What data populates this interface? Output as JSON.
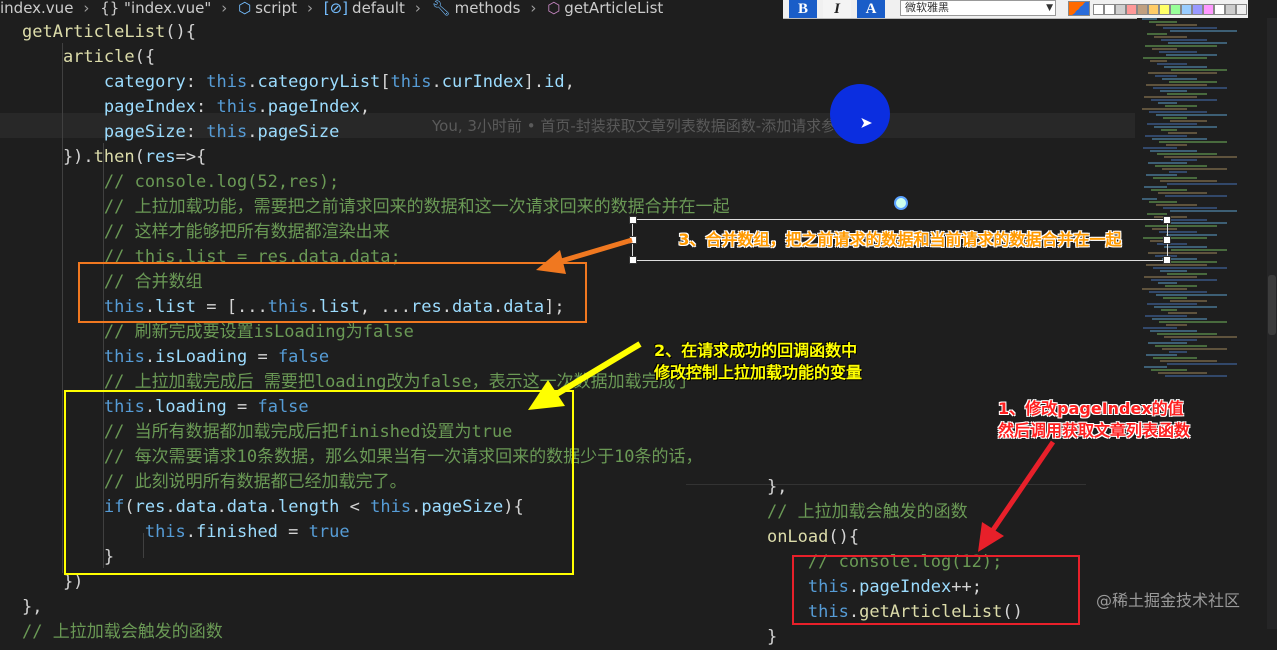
{
  "breadcrumb": [
    "index.vue",
    "{} \"index.vue\"",
    "script",
    "default",
    "methods",
    "getArticleList"
  ],
  "toolbar": {
    "bold": "B",
    "italic": "I",
    "color_a": "A",
    "font_name": "微软雅黑"
  },
  "code_lines": [
    "getArticleList(){",
    "    article({",
    "        category: this.categoryList[this.curIndex].id,",
    "        pageIndex: this.pageIndex,",
    "        pageSize: this.pageSize",
    "    }).then(res=>{",
    "        // console.log(52,res);",
    "        // 上拉加载功能，需要把之前请求回来的数据和这一次请求回来的数据合并在一起",
    "        // 这样才能够把所有数据都渲染出来",
    "        // this.list = res.data.data;",
    "        // 合并数组",
    "        this.list = [...this.list, ...res.data.data];",
    "        // 刷新完成要设置isLoading为false",
    "        this.isLoading = false",
    "        // 上拉加载完成后 需要把loading改为false，表示这一次数据加载完成了",
    "        this.loading = false",
    "        // 当所有数据都加载完成后把finished设置为true",
    "        // 每次需要请求10条数据，那么如果当有一次请求回来的数据少于10条的话，",
    "        // 此刻说明所有数据都已经加载完了。",
    "        if(res.data.data.length < this.pageSize){",
    "            this.finished = true",
    "        }",
    "    })",
    "},",
    "// 上拉加载会触发的函数"
  ],
  "blame": "You, 3小时前 • 首页-封装获取文章列表数据函数-添加请求参数 …",
  "inset_lines": [
    "    },",
    "    // 上拉加载会触发的函数",
    "    onLoad(){",
    "        // console.log(12);",
    "        this.pageIndex++;",
    "        this.getArticleList()",
    "    }"
  ],
  "callouts": {
    "step3": "3、合并数组，把之前请求的数据和当前请求的数据合并在一起",
    "step2_line1": "2、在请求成功的回调函数中",
    "step2_line2": "修改控制上拉加载功能的变量",
    "step1_line1": "1、修改pageIndex的值",
    "step1_line2": "然后调用获取文章列表函数"
  },
  "watermark": "@稀土掘金技术社区",
  "colors": {
    "editor_bg": "#1e1e1e",
    "keyword": "#569cd6",
    "property": "#9cdcfe",
    "comment": "#6a9955",
    "orange_box": "#f07820",
    "yellow_box": "#ffff00",
    "red_box": "#e8202a"
  }
}
